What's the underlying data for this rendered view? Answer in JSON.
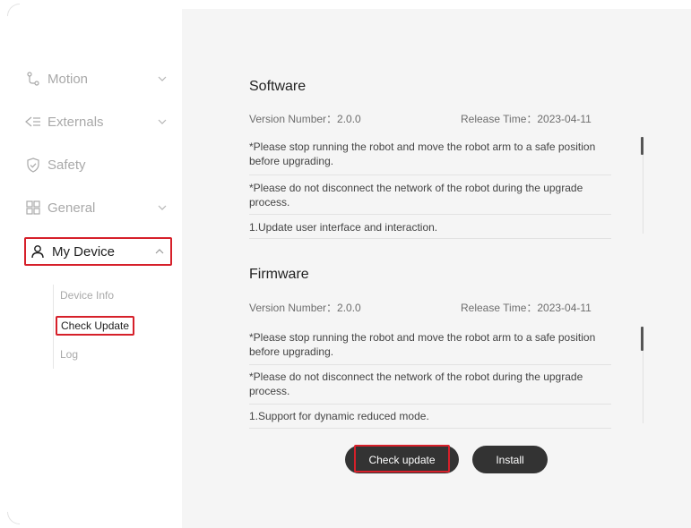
{
  "sidebar": {
    "items": [
      {
        "label": "Motion",
        "icon": "motion-icon",
        "chevron": "down"
      },
      {
        "label": "Externals",
        "icon": "externals-icon",
        "chevron": "down"
      },
      {
        "label": "Safety",
        "icon": "shield-check-icon",
        "chevron": ""
      },
      {
        "label": "General",
        "icon": "grid-icon",
        "chevron": "down"
      },
      {
        "label": "My Device",
        "icon": "user-icon",
        "chevron": "up"
      }
    ],
    "sub_items": [
      "Device Info",
      "Check Update",
      "Log"
    ]
  },
  "software": {
    "title": "Software",
    "version": "Version Number：2.0.0",
    "release": "Release Time：2023-04-11",
    "notes": [
      "*Please stop running the robot and move the robot arm to a safe position before upgrading.",
      "*Please do not disconnect the network of the robot during the upgrade process.",
      "1.Update user interface and interaction."
    ]
  },
  "firmware": {
    "title": "Firmware",
    "version": "Version Number：2.0.0",
    "release": "Release Time：2023-04-11",
    "notes": [
      "*Please stop running the robot and move the robot arm to a safe position before upgrading.",
      "*Please do not disconnect the network of the robot during the upgrade process.",
      "1.Support for dynamic reduced mode."
    ]
  },
  "buttons": {
    "check_update": "Check update",
    "install": "Install"
  },
  "colors": {
    "highlight": "#d6202a",
    "button_bg": "#333333",
    "main_bg": "#f5f5f5"
  }
}
